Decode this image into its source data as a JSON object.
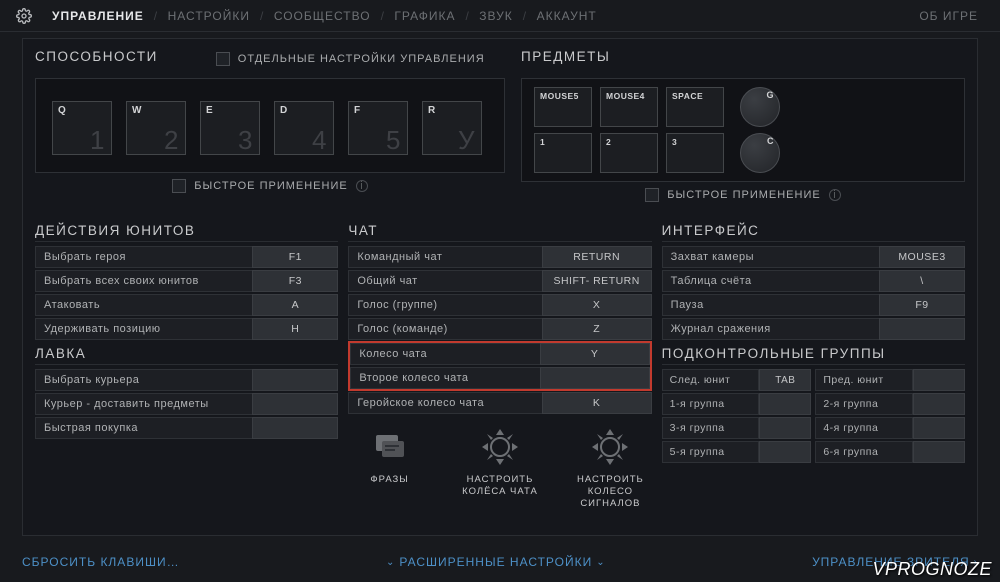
{
  "nav": {
    "tabs": [
      "УПРАВЛЕНИЕ",
      "НАСТРОЙКИ",
      "СООБЩЕСТВО",
      "ГРАФИКА",
      "ЗВУК",
      "АККАУНТ"
    ],
    "active_index": 0,
    "about": "ОБ ИГРЕ"
  },
  "abilities": {
    "title": "СПОСОБНОСТИ",
    "separate_cb_label": "ОТДЕЛЬНЫЕ НАСТРОЙКИ УПРАВЛЕНИЯ",
    "slots": [
      {
        "key": "Q",
        "num": "1"
      },
      {
        "key": "W",
        "num": "2"
      },
      {
        "key": "E",
        "num": "3"
      },
      {
        "key": "D",
        "num": "4"
      },
      {
        "key": "F",
        "num": "5"
      },
      {
        "key": "R",
        "num": "У"
      }
    ],
    "quickcast_label": "БЫСТРОЕ ПРИМЕНЕНИЕ"
  },
  "items": {
    "title": "ПРЕДМЕТЫ",
    "slots": [
      {
        "key": "MOUSE5"
      },
      {
        "key": "MOUSE4"
      },
      {
        "key": "SPACE"
      },
      {
        "key": "1"
      },
      {
        "key": "2"
      },
      {
        "key": "3"
      }
    ],
    "circle_keys": [
      "G",
      "C"
    ],
    "quickcast_label": "БЫСТРОЕ ПРИМЕНЕНИЕ"
  },
  "unit_actions": {
    "title": "ДЕЙСТВИЯ ЮНИТОВ",
    "rows": [
      {
        "label": "Выбрать героя",
        "val": "F1"
      },
      {
        "label": "Выбрать всех своих юнитов",
        "val": "F3"
      },
      {
        "label": "Атаковать",
        "val": "A"
      },
      {
        "label": "Удерживать позицию",
        "val": "H"
      }
    ]
  },
  "shop": {
    "title": "ЛАВКА",
    "rows": [
      {
        "label": "Выбрать курьера",
        "val": ""
      },
      {
        "label": "Курьер - доставить предметы",
        "val": ""
      },
      {
        "label": "Быстрая покупка",
        "val": ""
      }
    ]
  },
  "chat": {
    "title": "ЧАТ",
    "rows_top": [
      {
        "label": "Командный чат",
        "val": "RETURN"
      },
      {
        "label": "Общий чат",
        "val": "SHIFT- RETURN"
      },
      {
        "label": "Голос (группе)",
        "val": "X"
      },
      {
        "label": "Голос (команде)",
        "val": "Z"
      }
    ],
    "rows_highlight": [
      {
        "label": "Колесо чата",
        "val": "Y"
      },
      {
        "label": "Второе колесо чата",
        "val": ""
      }
    ],
    "rows_after": [
      {
        "label": "Геройское колесо чата",
        "val": "K"
      }
    ],
    "icons": {
      "phrases": "ФРАЗЫ",
      "chat_wheels": "НАСТРОИТЬ КОЛЁСА ЧАТА",
      "signal_wheel": "НАСТРОИТЬ КОЛЕСО СИГНАЛОВ"
    }
  },
  "interface": {
    "title": "ИНТЕРФЕЙС",
    "rows": [
      {
        "label": "Захват камеры",
        "val": "MOUSE3"
      },
      {
        "label": "Таблица счёта",
        "val": "\\"
      },
      {
        "label": "Пауза",
        "val": "F9"
      },
      {
        "label": "Журнал сражения",
        "val": ""
      }
    ]
  },
  "control_groups": {
    "title": "ПОДКОНТРОЛЬНЫЕ ГРУППЫ",
    "top_row": {
      "next": "След. юнит",
      "next_val": "TAB",
      "prev": "Пред. юнит",
      "prev_val": ""
    },
    "grid": [
      {
        "l": "1-я группа",
        "lv": "",
        "r": "2-я группа",
        "rv": ""
      },
      {
        "l": "3-я группа",
        "lv": "",
        "r": "4-я группа",
        "rv": ""
      },
      {
        "l": "5-я группа",
        "lv": "",
        "r": "6-я группа",
        "rv": ""
      }
    ]
  },
  "bottom": {
    "reset": "СБРОСИТЬ КЛАВИШИ…",
    "advanced": "РАСШИРЕННЫЕ НАСТРОЙКИ",
    "spectator": "УПРАВЛЕНИЕ ЗРИТЕЛЯ"
  },
  "watermark": "VPROGNOZE"
}
